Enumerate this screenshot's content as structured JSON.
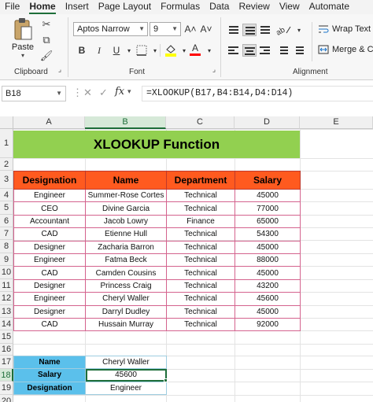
{
  "menu": {
    "tabs": [
      "File",
      "Home",
      "Insert",
      "Page Layout",
      "Formulas",
      "Data",
      "Review",
      "View",
      "Automate"
    ],
    "active": "Home"
  },
  "ribbon": {
    "paste_label": "Paste",
    "clipboard_label": "Clipboard",
    "font_name": "Aptos Narrow",
    "font_size": "9",
    "font_label": "Font",
    "bold": "B",
    "italic": "I",
    "underline": "U",
    "grow_font": "A˄",
    "shrink_font": "A˅",
    "font_color_letter": "A",
    "alignment_label": "Alignment",
    "wrap_text": "Wrap Text",
    "merge_center": "Merge & Ce",
    "colors": {
      "fill": "#ffff00",
      "font_color": "#ff0000",
      "accent": "#1e6e3a"
    }
  },
  "formula_bar": {
    "name_box": "B18",
    "fx": "fx",
    "formula": "=XLOOKUP(B17,B4:B14,D4:D14)"
  },
  "grid": {
    "columns": [
      "A",
      "B",
      "C",
      "D",
      "E"
    ],
    "selected_column": "B",
    "rows": [
      "1",
      "2",
      "3",
      "4",
      "5",
      "6",
      "7",
      "8",
      "9",
      "10",
      "11",
      "12",
      "13",
      "14",
      "15",
      "16",
      "17",
      "18",
      "19",
      "20"
    ],
    "selected_row": "18"
  },
  "sheet": {
    "title": "XLOOKUP Function",
    "headers": [
      "Designation",
      "Name",
      "Department",
      "Salary"
    ],
    "rows": [
      [
        "Engineer",
        "Summer-Rose Cortes",
        "Technical",
        "45000"
      ],
      [
        "CEO",
        "Divine Garcia",
        "Technical",
        "77000"
      ],
      [
        "Accountant",
        "Jacob Lowry",
        "Finance",
        "65000"
      ],
      [
        "CAD",
        "Etienne Hull",
        "Technical",
        "54300"
      ],
      [
        "Designer",
        "Zacharia Barron",
        "Technical",
        "45000"
      ],
      [
        "Engineer",
        "Fatma Beck",
        "Technical",
        "88000"
      ],
      [
        "CAD",
        "Camden Cousins",
        "Technical",
        "45000"
      ],
      [
        "Designer",
        "Princess Craig",
        "Technical",
        "43200"
      ],
      [
        "Engineer",
        "Cheryl Waller",
        "Technical",
        "45600"
      ],
      [
        "Designer",
        "Darryl Dudley",
        "Technical",
        "45000"
      ],
      [
        "CAD",
        "Hussain Murray",
        "Technical",
        "92000"
      ]
    ],
    "lookup": [
      {
        "label": "Name",
        "value": "Cheryl Waller"
      },
      {
        "label": "Salary",
        "value": "45600"
      },
      {
        "label": "Designation",
        "value": "Engineer"
      }
    ]
  }
}
